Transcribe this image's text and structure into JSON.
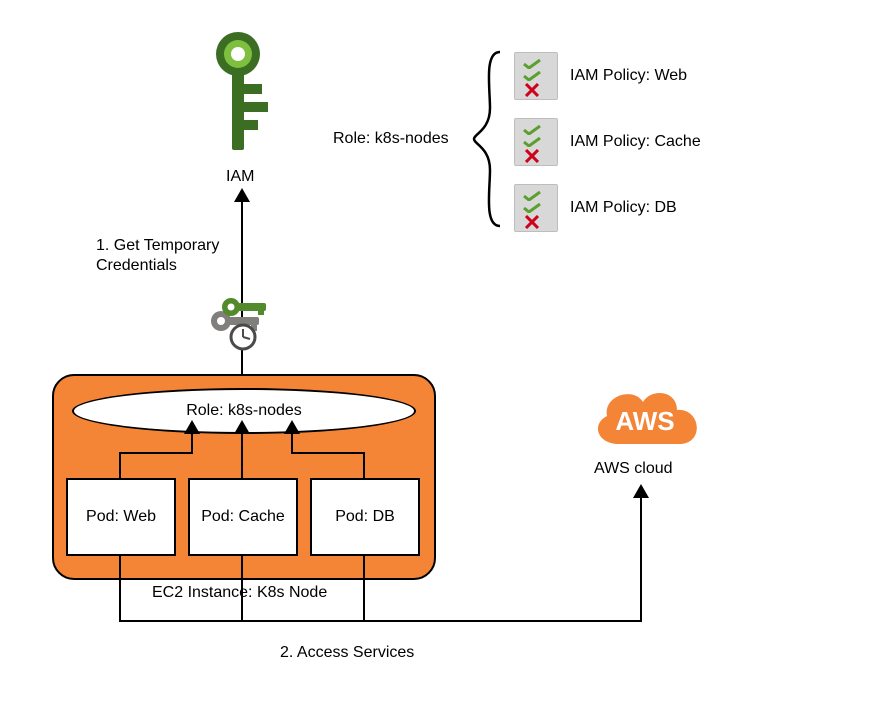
{
  "iam": {
    "label": "IAM"
  },
  "steps": {
    "get_credentials_label": "1. Get Temporary\nCredentials",
    "access_services_label": "2. Access Services"
  },
  "role": {
    "title_prefix": "Role: ",
    "name": "k8s-nodes",
    "top_label": "Role: k8s-nodes",
    "box_label": "Role: k8s-nodes"
  },
  "policies": {
    "web": {
      "label": "IAM Policy: Web"
    },
    "cache": {
      "label": "IAM Policy: Cache"
    },
    "db": {
      "label": "IAM Policy: DB"
    }
  },
  "ec2": {
    "label": "EC2 Instance: K8s Node",
    "pods": {
      "web": {
        "label": "Pod: Web"
      },
      "cache": {
        "label": "Pod: Cache"
      },
      "db": {
        "label": "Pod: DB"
      }
    }
  },
  "aws_cloud": {
    "logo_text": "AWS",
    "caption": "AWS cloud"
  }
}
